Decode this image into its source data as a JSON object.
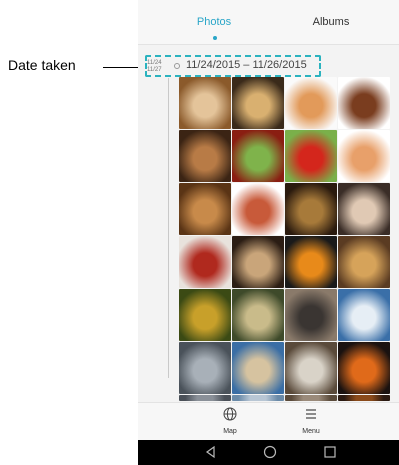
{
  "tabs": {
    "photos": "Photos",
    "albums": "Albums",
    "active": "Photos"
  },
  "timeline": {
    "mini_start": "11/24",
    "mini_end": "11/27",
    "range": "11/24/2015 – 11/26/2015"
  },
  "callout": {
    "label": "Date taken"
  },
  "photos": [
    {
      "name": "collage",
      "c1": "#8b5a2b",
      "c2": "#e4c49a"
    },
    {
      "name": "pastries-tray",
      "c1": "#3a2a1a",
      "c2": "#d9b070"
    },
    {
      "name": "donuts",
      "c1": "#fafafa",
      "c2": "#e29a5a"
    },
    {
      "name": "tart",
      "c1": "#ffffff",
      "c2": "#7a3d1f"
    },
    {
      "name": "cookies",
      "c1": "#3b2414",
      "c2": "#b87b46"
    },
    {
      "name": "pepper-salad",
      "c1": "#8a1e12",
      "c2": "#7fb34b"
    },
    {
      "name": "strawberries",
      "c1": "#7ab04a",
      "c2": "#d4261c"
    },
    {
      "name": "donut-single",
      "c1": "#ffffff",
      "c2": "#e8a06a"
    },
    {
      "name": "bread",
      "c1": "#5a3415",
      "c2": "#c88a4a"
    },
    {
      "name": "salad-plate",
      "c1": "#ffffff",
      "c2": "#c85a3a"
    },
    {
      "name": "dessert-dark",
      "c1": "#2a1a0e",
      "c2": "#a77a3a"
    },
    {
      "name": "donuts-dark",
      "c1": "#3a2d27",
      "c2": "#e0c9b4"
    },
    {
      "name": "bbq-skewers",
      "c1": "#e8e2dc",
      "c2": "#b0291e"
    },
    {
      "name": "cookies-dark",
      "c1": "#2b1d14",
      "c2": "#c9a57a"
    },
    {
      "name": "orange-slices",
      "c1": "#1a1a1a",
      "c2": "#e88a1a"
    },
    {
      "name": "croissants",
      "c1": "#5a3b22",
      "c2": "#d6a35a"
    },
    {
      "name": "soup-bowl",
      "c1": "#3b4a14",
      "c2": "#c8a02a"
    },
    {
      "name": "tea-set",
      "c1": "#3e4a2a",
      "c2": "#c9bb8a"
    },
    {
      "name": "portrait",
      "c1": "#8a7a6a",
      "c2": "#3a3532"
    },
    {
      "name": "beach-chair",
      "c1": "#3a6fa8",
      "c2": "#e6eef5"
    },
    {
      "name": "grey-sky",
      "c1": "#4a525a",
      "c2": "#a8b0b8"
    },
    {
      "name": "seaside",
      "c1": "#3a6ea5",
      "c2": "#d6c3a0"
    },
    {
      "name": "bicycle",
      "c1": "#5a4a3a",
      "c2": "#d9d3c8"
    },
    {
      "name": "pumpkins",
      "c1": "#1a1210",
      "c2": "#e06a1a"
    },
    {
      "name": "partial-1",
      "c1": "#4a5058",
      "c2": "#8a9098"
    },
    {
      "name": "partial-2",
      "c1": "#6a8aa8",
      "c2": "#b8c6d4"
    },
    {
      "name": "partial-3",
      "c1": "#5a4a3a",
      "c2": "#9a8a7a"
    },
    {
      "name": "partial-4",
      "c1": "#2a1a12",
      "c2": "#8a4a1a"
    }
  ],
  "footer": {
    "map_label": "Map",
    "menu_label": "Menu"
  },
  "colors": {
    "accent": "#2aa6c8",
    "callout": "#2bb3bf"
  }
}
